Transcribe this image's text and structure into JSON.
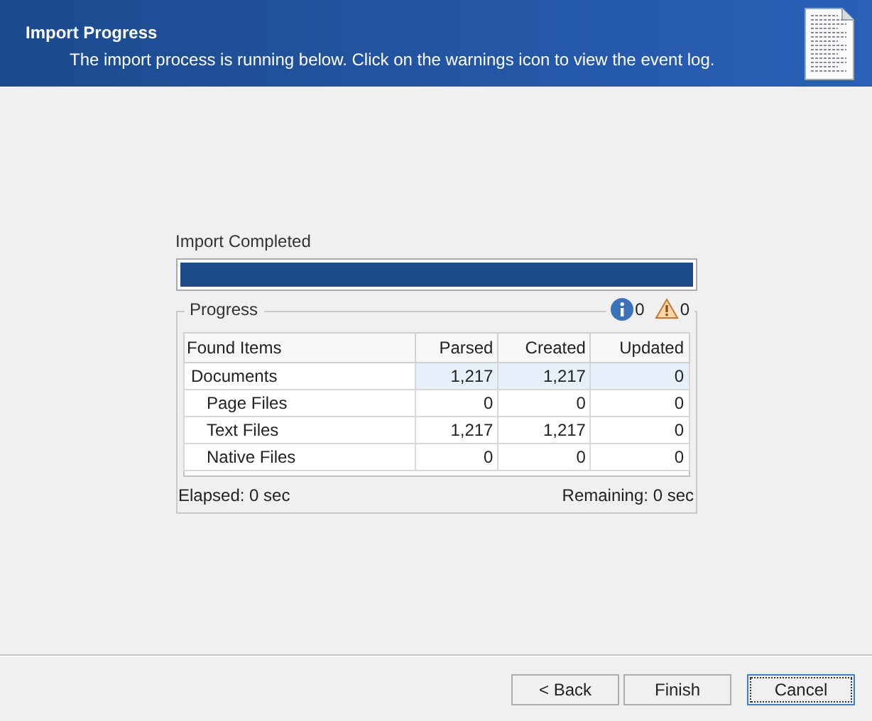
{
  "header": {
    "title": "Import Progress",
    "subtitle": "The import process is running below. Click on the warnings icon to view the event log."
  },
  "status": {
    "label": "Import Completed",
    "level": 1
  },
  "progress": {
    "title": "Progress",
    "info_count": "0",
    "warning_count": "0",
    "columns": [
      "Found Items",
      "Parsed",
      "Created",
      "Updated"
    ],
    "rows": [
      {
        "name": "Documents",
        "values": [
          "1,217",
          "1,217",
          "0"
        ],
        "selected": true,
        "children": [
          {
            "name": "Page Files",
            "values": [
              "0",
              "0",
              "0"
            ],
            "selected": false
          },
          {
            "name": "Text Files",
            "values": [
              "1,217",
              "1,217",
              "0"
            ],
            "selected": false
          },
          {
            "name": "Native Files",
            "values": [
              "0",
              "0",
              "0"
            ],
            "selected": false
          }
        ]
      }
    ],
    "elapsed": "Elapsed: 0 sec",
    "remaining": "Remaining: 0 sec"
  },
  "buttons": [
    {
      "label": "< Back",
      "focused": false
    },
    {
      "label": "Finish",
      "focused": false
    },
    {
      "label": "Cancel",
      "focused": true
    }
  ]
}
